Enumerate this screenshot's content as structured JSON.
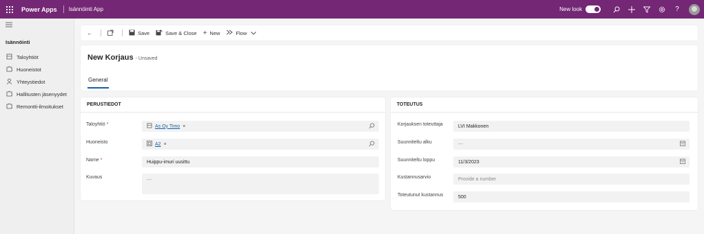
{
  "topbar": {
    "brand": "Power Apps",
    "app_name": "Isännöinti App",
    "new_look_label": "New look",
    "new_look_on": true,
    "icons": [
      "search-icon",
      "plus-icon",
      "filter-icon",
      "settings-icon",
      "help-icon",
      "avatar"
    ]
  },
  "sidebar": {
    "group_label": "Isännöinti",
    "items": [
      {
        "label": "Taloyhtiöt",
        "icon": "building-icon"
      },
      {
        "label": "Huoneistot",
        "icon": "puzzle-icon"
      },
      {
        "label": "Yhteystiedot",
        "icon": "person-icon"
      },
      {
        "label": "Hallitusten jäsenyydet",
        "icon": "puzzle-icon"
      },
      {
        "label": "Remontti-ilmoitukset",
        "icon": "puzzle-icon"
      }
    ]
  },
  "commandbar": {
    "save": "Save",
    "save_close": "Save & Close",
    "new": "New",
    "flow": "Flow"
  },
  "record": {
    "title": "New Korjaus",
    "status": "- Unsaved",
    "tab": "General"
  },
  "perustiedot": {
    "title": "PERUSTIEDOT",
    "taloyhtio_label": "Taloyhtiö",
    "taloyhtio_value": "As Oy Timo",
    "huoneisto_label": "Huoneisto",
    "huoneisto_value": "A2",
    "name_label": "Name",
    "name_value": "Huippu-imuri uusittu",
    "kuvaus_label": "Kuvaus",
    "kuvaus_value": "---"
  },
  "toteutus": {
    "title": "TOTEUTUS",
    "toteuttaja_label": "Korjauksen toteuttaja",
    "toteuttaja_value": "LVI Makkonen",
    "alku_label": "Suunniteltu alku",
    "alku_value": "---",
    "loppu_label": "Suunniteltu loppu",
    "loppu_value": "11/3/2023",
    "arvio_label": "Kustannusarvio",
    "arvio_placeholder": "Provide a number",
    "toteutunut_label": "Toteutunut kustannus",
    "toteutunut_value": "500"
  },
  "required_marker": "*",
  "colors": {
    "brand": "#742774",
    "accent": "#115ea3",
    "required": "#c4314b"
  }
}
